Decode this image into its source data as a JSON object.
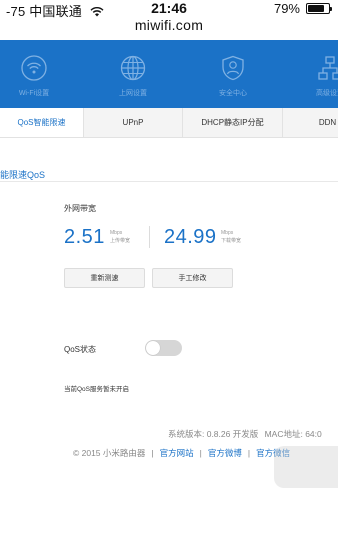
{
  "status_bar": {
    "carrier": "-75 中国联通",
    "time": "21:46",
    "battery_percent": "79%",
    "battery_level": 0.79
  },
  "browser": {
    "url": "miwifi.com"
  },
  "topnav": {
    "items": [
      {
        "label": "Wi-Fi设置",
        "icon": "wifi-icon"
      },
      {
        "label": "上网设置",
        "icon": "globe-icon"
      },
      {
        "label": "安全中心",
        "icon": "shield-user-icon"
      },
      {
        "label": "高级设置",
        "icon": "network-icon"
      }
    ]
  },
  "subtabs": {
    "items": [
      {
        "label": "QoS智能限速",
        "active": true
      },
      {
        "label": "UPnP",
        "active": false
      },
      {
        "label": "DHCP静态IP分配",
        "active": false
      },
      {
        "label": "DDN",
        "active": false
      }
    ]
  },
  "qos_section": {
    "title": "能限速QoS",
    "bandwidth_label": "外网带宽",
    "upload": {
      "value": "2.51",
      "unit": "Mbps",
      "caption": "上传带宽"
    },
    "download": {
      "value": "24.99",
      "unit": "Mbps",
      "caption": "下载带宽"
    },
    "retest_button": "重新测速",
    "manual_button": "手工修改",
    "qos_status_label": "QoS状态",
    "qos_enabled": false,
    "qos_status_text": "当前QoS服务暂未开启"
  },
  "footer": {
    "version_text": "系统版本: 0.8.26 开发版",
    "mac_text": "MAC地址: 64:0",
    "copyright": "© 2015 小米路由器",
    "links": [
      "官方网站",
      "官方微博",
      "官方微信"
    ]
  },
  "colors": {
    "brand_blue": "#1b72c7",
    "toggle_off": "#d6d6d6"
  }
}
